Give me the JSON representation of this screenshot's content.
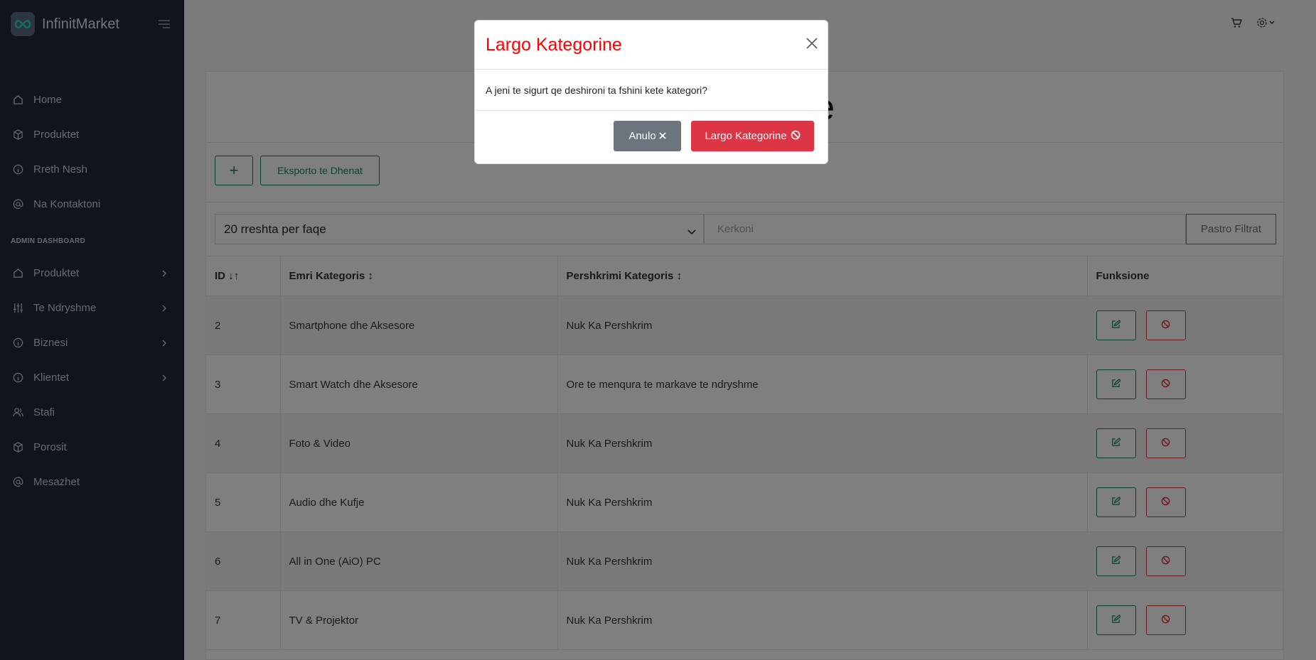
{
  "app": {
    "name": "InfinitMarket"
  },
  "sidebar": {
    "main_items": [
      {
        "label": "Home",
        "icon": "home-icon"
      },
      {
        "label": "Produktet",
        "icon": "box-icon"
      },
      {
        "label": "Rreth Nesh",
        "icon": "info-icon"
      },
      {
        "label": "Na Kontaktoni",
        "icon": "at-icon"
      }
    ],
    "admin_heading": "ADMIN DASHBOARD",
    "admin_items": [
      {
        "label": "Produktet",
        "icon": "home-icon"
      },
      {
        "label": "Te Ndryshme",
        "icon": "sliders-icon"
      },
      {
        "label": "Biznesi",
        "icon": "info-icon"
      },
      {
        "label": "Klientet",
        "icon": "info-icon"
      },
      {
        "label": "Stafi",
        "icon": "users-icon"
      },
      {
        "label": "Porosit",
        "icon": "box-icon"
      },
      {
        "label": "Mesazhet",
        "icon": "at-icon"
      }
    ]
  },
  "page": {
    "title": "Produkteve",
    "export_label": "Eksporto te Dhenat",
    "add_label": "+",
    "rows_per_page": "20 rreshta per faqe",
    "search_placeholder": "Kerkoni",
    "clear_filters": "Pastro Filtrat"
  },
  "table": {
    "headers": [
      "ID",
      "Emri Kategoris",
      "Pershkrimi Kategoris",
      "Funksione"
    ],
    "rows": [
      {
        "id": "2",
        "name": "Smartphone dhe Aksesore",
        "desc": "Nuk Ka Pershkrim"
      },
      {
        "id": "3",
        "name": "Smart Watch dhe Aksesore",
        "desc": "Ore te menqura te markave te ndryshme"
      },
      {
        "id": "4",
        "name": "Foto & Video",
        "desc": "Nuk Ka Pershkrim"
      },
      {
        "id": "5",
        "name": "Audio dhe Kufje",
        "desc": "Nuk Ka Pershkrim"
      },
      {
        "id": "6",
        "name": "All in One (AiO) PC",
        "desc": "Nuk Ka Pershkrim"
      },
      {
        "id": "7",
        "name": "TV & Projektor",
        "desc": "Nuk Ka Pershkrim"
      }
    ]
  },
  "modal": {
    "title": "Largo Kategorine",
    "message": "A jeni te sigurt qe deshironi ta fshini kete kategori?",
    "cancel_label": "Anulo",
    "confirm_label": "Largo Kategorine"
  },
  "colors": {
    "sidebar_bg": "#1e293b",
    "success": "#198754",
    "danger": "#dc3545",
    "secondary": "#6c757d",
    "modal_title": "#ff0000"
  }
}
